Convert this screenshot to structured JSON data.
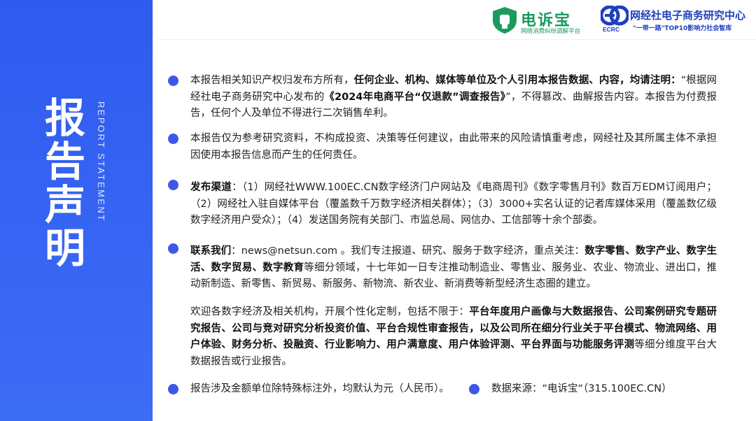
{
  "sidebar": {
    "title": "报告声明",
    "subtitle": "REPORT STATEMENT"
  },
  "logos": {
    "left_name": "电诉宝",
    "left_tagline": "网络消费纠纷调解平台",
    "right_mark": "ECRC",
    "right_name": "网经社电子商务研究中心",
    "right_tagline": "\"一带一路\"TOP10影响力社会智库"
  },
  "colors": {
    "accent": "#3d58e6",
    "panel": "#2f5bf0",
    "green": "#1b9a5e"
  },
  "paragraphs": {
    "p1": [
      {
        "t": "本报告相关知识产权归发布方所有，",
        "b": false
      },
      {
        "t": "任何企业、机构、媒体等单位及个人引用本报告数据、内容，均请注明：",
        "b": true
      },
      {
        "t": "“根据网经社电子商务研究中心发布的",
        "b": false
      },
      {
        "t": "《2024年电商平台“仅退款”调查报告》",
        "b": true
      },
      {
        "t": "”，不得篡改、曲解报告内容。本报告为付费报告，任何个人及单位不得进行二次销售牟利。",
        "b": false
      }
    ],
    "p2": [
      {
        "t": "本报告仅为参考研究资料，不构成投资、决策等任何建议，由此带来的风险请慎重考虑，网经社及其所属主体不承担因使用本报告信息而产生的任何责任。",
        "b": false
      }
    ],
    "p3": [
      {
        "t": "发布渠道",
        "b": true
      },
      {
        "t": "：（1）网经社WWW.100EC.CN数字经济门户网站及《电商周刊》《数字零售月刊》数百万EDM订阅用户；（2）网经社入驻自媒体平台（覆盖数千万数字经济相关群体）；（3）3000+实名认证的记者库媒体采用（覆盖数亿级数字经济用户受众）；（4）发送国务院有关部门、市监总局、网信办、工信部等十余个部委。",
        "b": false
      }
    ],
    "p4": [
      {
        "t": "联系我们",
        "b": true
      },
      {
        "t": "：news@netsun.com 。我们专注报道、研究、服务于数字经济，重点关注：",
        "b": false
      },
      {
        "t": "数字零售、数字产业、数字生活、数字贸易、数字教育",
        "b": true
      },
      {
        "t": "等细分领域，十七年如一日专注推动制造业、零售业、服务业、农业、物流业、进出口，推动新制造、新零售、新贸易、新服务、新物流、新农业、新消费等新型经济生态圈的建立。",
        "b": false
      }
    ],
    "p5": [
      {
        "t": "欢迎各数字经济及相关机构，开展个性化定制，包括不限于：",
        "b": false
      },
      {
        "t": "平台年度用户画像与大数据报告、公司案例研究专题研究报告、公司与竞对研究分析投资价值、平台合规性审查报告，以及公司所在细分行业关于平台模式、物流网络、用户体验、财务分析、投融资、行业影响力、用户满意度、用户体验评测、平台界面与功能服务评测",
        "b": true
      },
      {
        "t": "等细分维度平台大数据报告或行业报告。",
        "b": false
      }
    ],
    "bottom_left": "报告涉及金额单位除特殊标注外，均默认为元（人民币）。",
    "bottom_right": "数据来源：“电诉宝“（315.100EC.CN）"
  }
}
